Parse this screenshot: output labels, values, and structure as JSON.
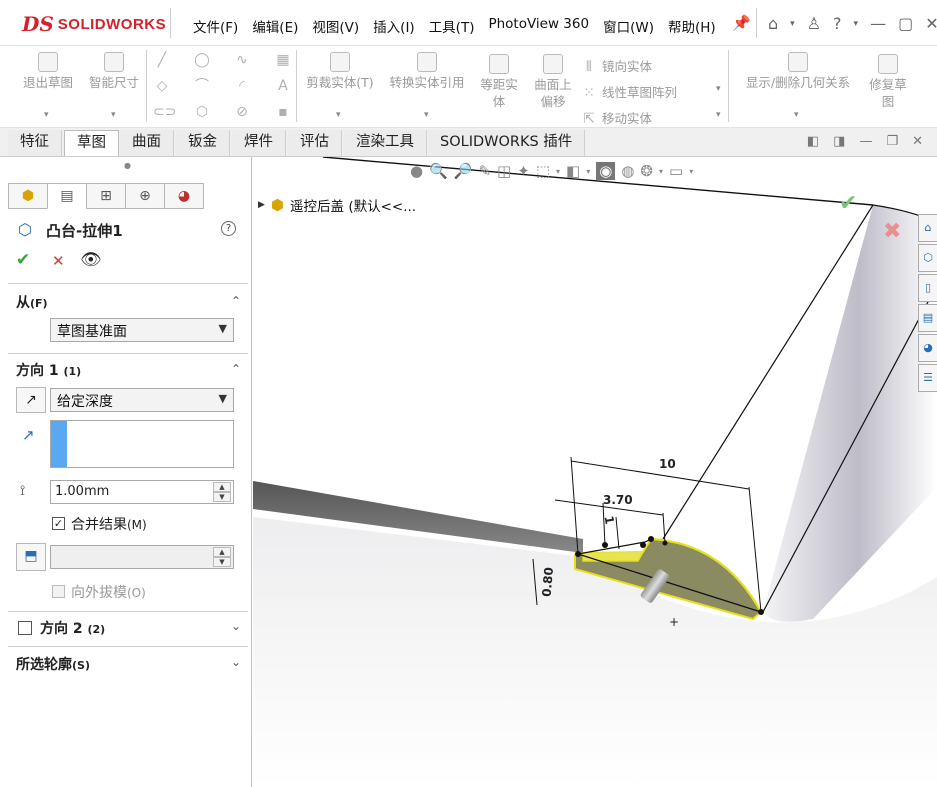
{
  "app": {
    "brand_ds": "DS",
    "brand_name": "SOLIDWORKS"
  },
  "menu": [
    "文件(F)",
    "编辑(E)",
    "视图(V)",
    "插入(I)",
    "工具(T)",
    "PhotoView 360",
    "窗口(W)",
    "帮助(H)"
  ],
  "commands": {
    "exit_sketch": "退出草图",
    "smart_dimension": "智能尺寸",
    "trim_entities": "剪裁实体(T)",
    "convert_entities": "转换实体引用",
    "offset_line1": "等距实",
    "offset_line2": "体",
    "surface_offset_line1": "曲面上",
    "surface_offset_line2": "偏移",
    "mirror_entities": "镜向实体",
    "linear_pattern": "线性草图阵列",
    "move_entities": "移动实体",
    "display_relations": "显示/删除几何关系",
    "repair_line1": "修复草",
    "repair_line2": "图"
  },
  "tabs": [
    "特征",
    "草图",
    "曲面",
    "钣金",
    "焊件",
    "评估",
    "渲染工具",
    "SOLIDWORKS 插件"
  ],
  "active_tab": "草图",
  "feature": {
    "title": "凸台-拉伸1",
    "from_label": "从",
    "from_shortcut": "(F)",
    "from_value": "草图基准面",
    "dir1_label": "方向 1",
    "dir1_shortcut": "(1)",
    "end_condition": "给定深度",
    "depth": "1.00mm",
    "merge_label": "合并结果",
    "merge_shortcut": "(M)",
    "merge_checked": true,
    "draft_label": "向外拔模",
    "draft_shortcut": "(O)",
    "dir2_label": "方向 2",
    "dir2_shortcut": "(2)",
    "selected_contours": "所选轮廓",
    "selected_contours_shortcut": "(S)"
  },
  "tree": {
    "root_label": "遥控后盖 (默认<<..."
  },
  "dimensions": {
    "d1": "10",
    "d2": "3.70",
    "d3": "1",
    "d4": "0.80"
  },
  "colors": {
    "accent": "#2a6fb6",
    "ok": "#3aa23a",
    "cancel": "#d23a2a",
    "sketch": "#e5e01a"
  }
}
